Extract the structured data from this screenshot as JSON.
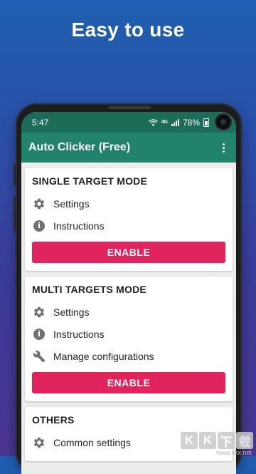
{
  "promo": {
    "title": "Easy to use"
  },
  "status_bar": {
    "time": "5:47",
    "network": "4G",
    "battery": "78%"
  },
  "app_bar": {
    "title": "Auto Clicker (Free)"
  },
  "cards": {
    "single": {
      "title": "SINGLE TARGET MODE",
      "settings_label": "Settings",
      "instructions_label": "Instructions",
      "enable_label": "ENABLE"
    },
    "multi": {
      "title": "MULTI TARGETS MODE",
      "settings_label": "Settings",
      "instructions_label": "Instructions",
      "configurations_label": "Manage configurations",
      "enable_label": "ENABLE"
    },
    "others": {
      "title": "OTHERS",
      "common_settings_label": "Common settings"
    }
  },
  "watermark": {
    "tiles": [
      "K",
      "K",
      "下",
      "载"
    ],
    "url": "www.kkx.net"
  },
  "colors": {
    "status_bar": "#1b6d57",
    "app_bar": "#21836a",
    "enable_button": "#e0245e",
    "background_top": "#1f5fb0",
    "background_bottom": "#4a3592"
  },
  "icons": [
    "gear-icon",
    "info-icon",
    "wrench-icon",
    "wifi-icon",
    "signal-icon",
    "battery-icon",
    "overflow-menu-icon"
  ]
}
